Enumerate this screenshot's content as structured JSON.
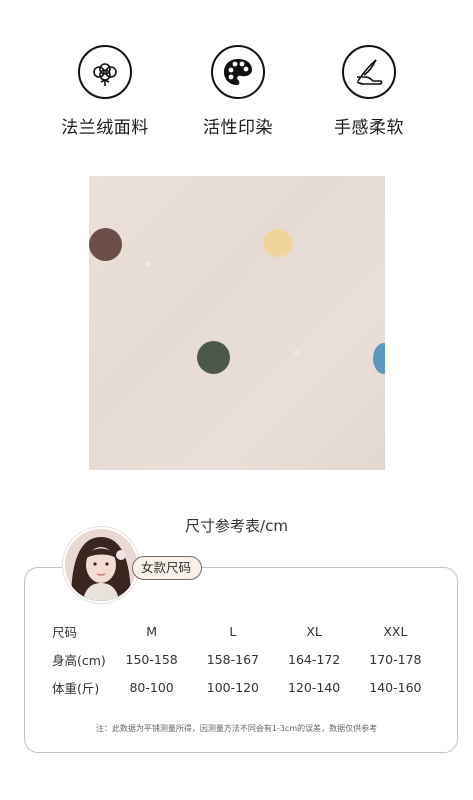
{
  "features": [
    {
      "label": "法兰绒面料",
      "icon": "cotton-icon"
    },
    {
      "label": "活性印染",
      "icon": "palette-icon"
    },
    {
      "label": "手感柔软",
      "icon": "hand-feather-icon"
    }
  ],
  "size_section": {
    "title": "尺寸参考表/cm",
    "tag": "女款尺码",
    "headers": [
      "尺码",
      "M",
      "L",
      "XL",
      "XXL"
    ],
    "rows": [
      [
        "身高(cm)",
        "150-158",
        "158-167",
        "164-172",
        "170-178"
      ],
      [
        "体重(斤)",
        "80-100",
        "100-120",
        "120-140",
        "140-160"
      ]
    ],
    "note": "注：此数据为平铺测量所得，因测量方法不同会有1-3cm的误差，数据仅供参考"
  }
}
